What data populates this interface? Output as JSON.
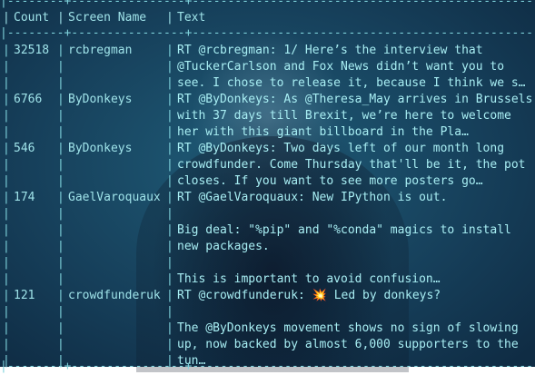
{
  "table": {
    "separator": "|--------+----------------+--------------------------------------------------------------|",
    "headers": {
      "count": "Count",
      "screen_name": "Screen Name",
      "text": "Text"
    },
    "rows": [
      {
        "count": "32518",
        "screen_name": "rcbregman",
        "lines": [
          "RT @rcbregman: 1/ Here’s the interview that",
          "@TuckerCarlson and Fox News didn’t want you to",
          "see. I chose to release it, because I think we s…"
        ]
      },
      {
        "count": "6766",
        "screen_name": "ByDonkeys",
        "lines": [
          "RT @ByDonkeys: As @Theresa_May arrives in Brussels",
          "with 37 days till Brexit, we’re here to welcome",
          "her with this giant billboard in the Pla…"
        ]
      },
      {
        "count": "546",
        "screen_name": "ByDonkeys",
        "lines": [
          "RT @ByDonkeys: Two days left of our month long",
          "crowdfunder. Come Thursday that'll be it, the pot",
          "closes. If you want to see more posters go…"
        ]
      },
      {
        "count": "174",
        "screen_name": "GaelVaroquaux",
        "lines": [
          "RT @GaelVaroquaux: New IPython is out.",
          "",
          "Big deal: \"%pip\" and \"%conda\" magics to install",
          "new packages.",
          "",
          "This is important to avoid confusion…"
        ]
      },
      {
        "count": "121",
        "screen_name": "crowdfunderuk",
        "lines": [
          "RT @crowdfunderuk: 💥 Led by donkeys?",
          "",
          "The @ByDonkeys movement shows no sign of slowing",
          "up, now backed by almost 6,000 supporters to the",
          "tun…"
        ]
      }
    ]
  }
}
